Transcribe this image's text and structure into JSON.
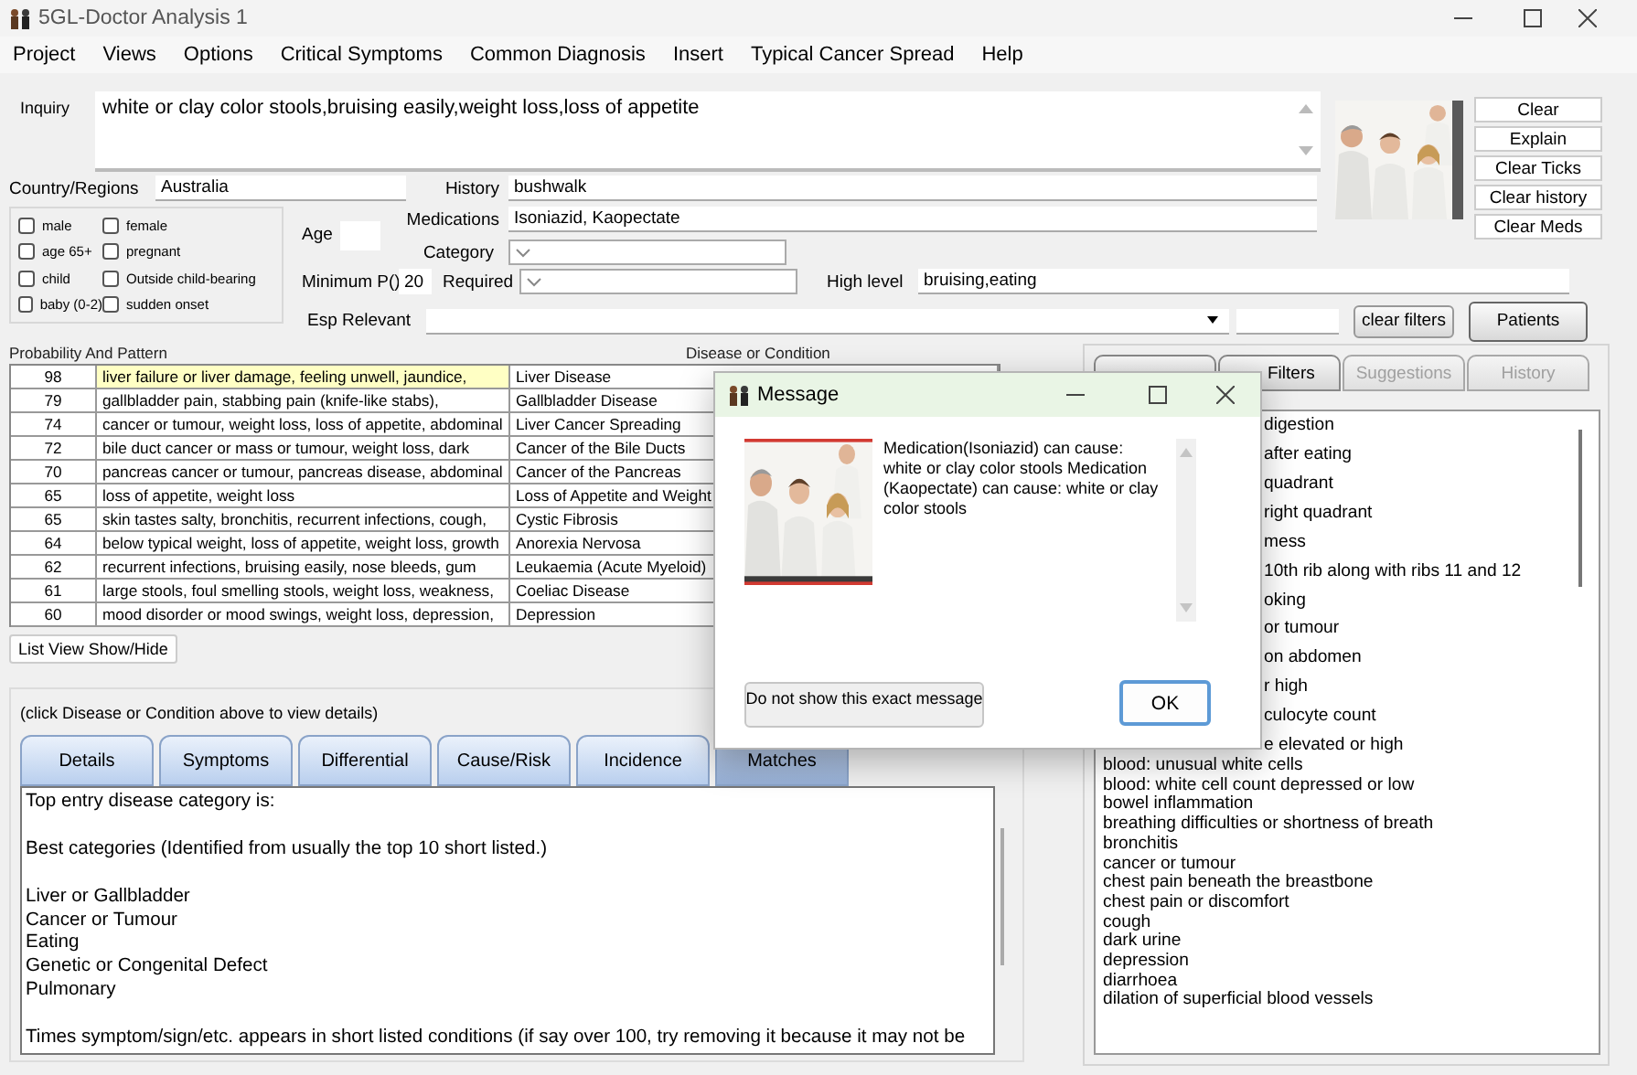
{
  "window": {
    "title": "5GL-Doctor Analysis 1"
  },
  "menu": [
    "Project",
    "Views",
    "Options",
    "Critical Symptoms",
    "Common Diagnosis",
    "Insert",
    "Typical Cancer Spread",
    "Help"
  ],
  "inquiry": {
    "label": "Inquiry",
    "value": "white or clay color stools,bruising easily,weight loss,loss of appetite"
  },
  "side_buttons": [
    "Clear",
    "Explain",
    "Clear Ticks",
    "Clear history",
    "Clear Meds"
  ],
  "country": {
    "label": "Country/Regions",
    "value": "Australia"
  },
  "history": {
    "label": "History",
    "value": "bushwalk"
  },
  "medications": {
    "label": "Medications",
    "value": "Isoniazid, Kaopectate"
  },
  "checkboxes": [
    {
      "label": "male",
      "checked": false
    },
    {
      "label": "female",
      "checked": false
    },
    {
      "label": "age 65+",
      "checked": false
    },
    {
      "label": "pregnant",
      "checked": false
    },
    {
      "label": "child",
      "checked": false
    },
    {
      "label": "Outside child-bearing",
      "checked": false
    },
    {
      "label": "baby (0-2)",
      "checked": false
    },
    {
      "label": "sudden onset",
      "checked": false
    }
  ],
  "age": {
    "label": "Age"
  },
  "category": {
    "label": "Category"
  },
  "minimum": {
    "label": "Minimum P()",
    "value": "20"
  },
  "required": {
    "label": "Required"
  },
  "high_level": {
    "label": "High level",
    "value": "bruising,eating"
  },
  "esp_relevant": {
    "label": "Esp Relevant"
  },
  "clear_filters": "clear filters",
  "patients": "Patients",
  "table": {
    "columns": [
      "Probability And Pattern",
      "Disease or Condition"
    ],
    "rows": [
      {
        "probability": "98",
        "pattern": "liver failure or liver damage, feeling unwell, jaundice,",
        "condition": "Liver Disease",
        "selected": true
      },
      {
        "probability": "79",
        "pattern": "gallbladder pain, stabbing pain (knife-like stabs),",
        "condition": "Gallbladder Disease",
        "selected": false
      },
      {
        "probability": "74",
        "pattern": "cancer or tumour, weight loss, loss of appetite, abdominal",
        "condition": "Liver Cancer Spreading",
        "selected": false
      },
      {
        "probability": "72",
        "pattern": "bile duct cancer or mass or tumour, weight loss, dark",
        "condition": "Cancer of the Bile Ducts",
        "selected": false
      },
      {
        "probability": "70",
        "pattern": "pancreas cancer or tumour, pancreas disease, abdominal",
        "condition": "Cancer of the Pancreas",
        "selected": false
      },
      {
        "probability": "65",
        "pattern": "loss of appetite, weight loss",
        "condition": "Loss of Appetite and Weight",
        "selected": false
      },
      {
        "probability": "65",
        "pattern": "skin tastes salty, bronchitis, recurrent infections, cough,",
        "condition": "Cystic Fibrosis",
        "selected": false
      },
      {
        "probability": "64",
        "pattern": "below typical weight, loss of appetite, weight loss, growth",
        "condition": "Anorexia Nervosa",
        "selected": false
      },
      {
        "probability": "62",
        "pattern": "recurrent infections, bruising easily, nose bleeds, gum",
        "condition": "Leukaemia (Acute Myeloid)",
        "selected": false
      },
      {
        "probability": "61",
        "pattern": "large stools, foul smelling stools, weight loss, weakness,",
        "condition": "Coeliac Disease",
        "selected": false
      },
      {
        "probability": "60",
        "pattern": "mood disorder or mood swings, weight loss, depression,",
        "condition": "Depression",
        "selected": false
      }
    ]
  },
  "list_view_button": "List View Show/Hide",
  "details": {
    "hint": "(click Disease or Condition above to view details)",
    "tabs": [
      {
        "label": "Details",
        "selected": false
      },
      {
        "label": "Symptoms",
        "selected": false
      },
      {
        "label": "Differential",
        "selected": false
      },
      {
        "label": "Cause/Risk",
        "selected": false
      },
      {
        "label": "Incidence",
        "selected": false
      },
      {
        "label": "Matches",
        "selected": true
      }
    ],
    "heading": "Top entry disease category is:",
    "best_label": "Best categories (Identified from usually the top 10 short listed.)",
    "categories": [
      "Liver or Gallbladder",
      "Cancer or Tumour",
      "Eating",
      "Genetic or Congenital Defect",
      "Pulmonary"
    ],
    "note": "Times symptom/sign/etc. appears in short listed conditions (if say over 100, try removing it because it may not be"
  },
  "right_panel": {
    "tabs": [
      {
        "disabled": false
      },
      {
        "label": "Filters",
        "disabled": false
      },
      {
        "label": "Suggestions",
        "disabled": true
      },
      {
        "label": "History",
        "disabled": true
      }
    ],
    "items": [
      {
        "text": "digestion",
        "kind": "partial"
      },
      {
        "text": "after eating",
        "kind": "partial"
      },
      {
        "text": "quadrant",
        "kind": "partial"
      },
      {
        "text": "right quadrant",
        "kind": "partial"
      },
      {
        "text": "mess",
        "kind": "partial"
      },
      {
        "text": "10th rib along with ribs 11 and 12",
        "kind": "partial"
      },
      {
        "text": "oking",
        "kind": "partial"
      },
      {
        "text": "or tumour",
        "kind": "partial"
      },
      {
        "text": "on abdomen",
        "kind": "partial"
      },
      {
        "text": "r high",
        "kind": "partial"
      },
      {
        "text": "culocyte count",
        "kind": "partial"
      },
      {
        "text": "e elevated or high",
        "kind": "partial"
      },
      {
        "text": "blood: unusual white cells",
        "kind": "full"
      },
      {
        "text": "blood: white cell count depressed or low",
        "kind": "full"
      },
      {
        "text": "bowel inflammation",
        "kind": "full"
      },
      {
        "text": "breathing difficulties or shortness of breath",
        "kind": "full"
      },
      {
        "text": "bronchitis",
        "kind": "full"
      },
      {
        "text": "cancer or tumour",
        "kind": "full"
      },
      {
        "text": "chest pain beneath the breastbone",
        "kind": "full"
      },
      {
        "text": "chest pain or discomfort",
        "kind": "full"
      },
      {
        "text": "cough",
        "kind": "full"
      },
      {
        "text": "dark urine",
        "kind": "full"
      },
      {
        "text": "depression",
        "kind": "full"
      },
      {
        "text": "diarrhoea",
        "kind": "full"
      },
      {
        "text": "dilation of superficial blood vessels",
        "kind": "full"
      }
    ]
  },
  "dialog": {
    "title": "Message",
    "message": "Medication(Isoniazid) can cause: white or clay color stools Medication (Kaopectate) can cause: white or clay color stools",
    "secondary_button": "Do not show this exact message",
    "ok_button": "OK"
  }
}
